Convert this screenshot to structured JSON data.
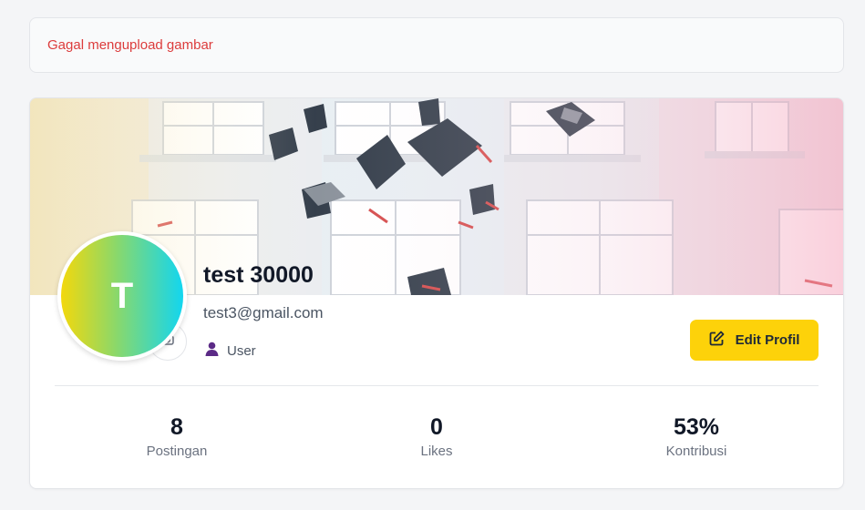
{
  "alert": {
    "message": "Gagal mengupload gambar"
  },
  "profile": {
    "avatar_initial": "T",
    "name": "test 30000",
    "email": "test3@gmail.com",
    "role": "User",
    "edit_button_label": "Edit Profil"
  },
  "stats": [
    {
      "value": "8",
      "label": "Postingan"
    },
    {
      "value": "0",
      "label": "Likes"
    },
    {
      "value": "53%",
      "label": "Kontribusi"
    }
  ],
  "icons": {
    "camera": "camera-icon",
    "user": "user-icon",
    "edit": "edit-icon"
  },
  "colors": {
    "error_text": "#dc3c3c",
    "button_yellow": "#fdd20a",
    "user_icon": "#5b2a86",
    "avatar_gradient_start": "#f3d80c",
    "avatar_gradient_end": "#12d6f0"
  }
}
